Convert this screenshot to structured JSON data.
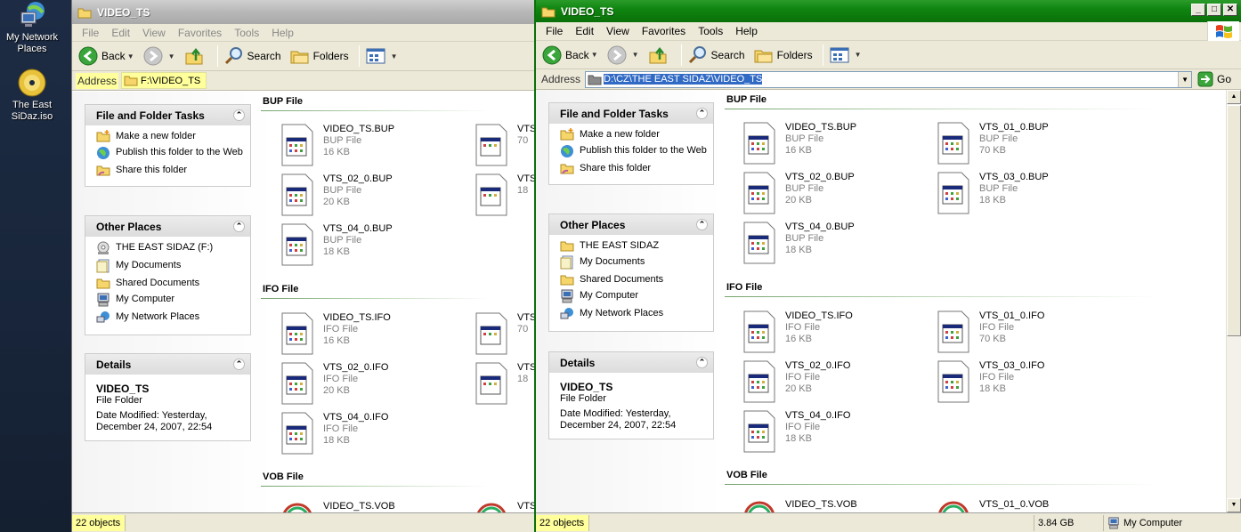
{
  "desktop": {
    "icons": [
      {
        "label": "My Network Places",
        "icon": "network-places-icon"
      },
      {
        "label": "The East SiDaz.iso",
        "icon": "cd-disc-icon"
      }
    ]
  },
  "menu": [
    "File",
    "Edit",
    "View",
    "Favorites",
    "Tools",
    "Help"
  ],
  "toolbar": {
    "back": "Back",
    "search": "Search",
    "folders": "Folders"
  },
  "colors": {
    "active_title": "#108510",
    "inactive_title": "#b7b7b7",
    "highlight": "#ffff9c",
    "selection": "#316ac5"
  },
  "left_window": {
    "title": "VIDEO_TS",
    "address_label": "Address",
    "address": "F:\\VIDEO_TS",
    "status": "22 objects",
    "other_places": [
      "THE EAST SIDAZ (F:)",
      "My Documents",
      "Shared Documents",
      "My Computer",
      "My Network Places"
    ]
  },
  "right_window": {
    "title": "VIDEO_TS",
    "address_label": "Address",
    "address": "D:\\CZ\\THE EAST SIDAZ\\VIDEO_TS",
    "go": "Go",
    "status": "22 objects",
    "status_size": "3.84 GB",
    "status_zone": "My Computer",
    "other_places": [
      "THE EAST SIDAZ",
      "My Documents",
      "Shared Documents",
      "My Computer",
      "My Network Places"
    ]
  },
  "tasks": {
    "title": "File and Folder Tasks",
    "items": [
      "Make a new folder",
      "Publish this folder to the Web",
      "Share this folder"
    ]
  },
  "other_places_title": "Other Places",
  "details": {
    "title": "Details",
    "name": "VIDEO_TS",
    "type": "File Folder",
    "modified": "Date Modified: Yesterday, December 24, 2007, 22:54"
  },
  "groups": [
    {
      "name": "BUP File",
      "files": [
        {
          "name": "VIDEO_TS.BUP",
          "type": "BUP File",
          "size": "16 KB"
        },
        {
          "name": "VTS_01_0.BUP",
          "type": "BUP File",
          "size": "70 KB"
        },
        {
          "name": "VTS_02_0.BUP",
          "type": "BUP File",
          "size": "20 KB"
        },
        {
          "name": "VTS_03_0.BUP",
          "type": "BUP File",
          "size": "18 KB"
        },
        {
          "name": "VTS_04_0.BUP",
          "type": "BUP File",
          "size": "18 KB"
        }
      ]
    },
    {
      "name": "IFO File",
      "files": [
        {
          "name": "VIDEO_TS.IFO",
          "type": "IFO File",
          "size": "16 KB"
        },
        {
          "name": "VTS_01_0.IFO",
          "type": "IFO File",
          "size": "70 KB"
        },
        {
          "name": "VTS_02_0.IFO",
          "type": "IFO File",
          "size": "20 KB"
        },
        {
          "name": "VTS_03_0.IFO",
          "type": "IFO File",
          "size": "18 KB"
        },
        {
          "name": "VTS_04_0.IFO",
          "type": "IFO File",
          "size": "18 KB"
        }
      ]
    },
    {
      "name": "VOB File",
      "files": [
        {
          "name": "VIDEO_TS.VOB",
          "type": "",
          "size": ""
        },
        {
          "name": "VTS_01_0.VOB",
          "type": "",
          "size": ""
        }
      ]
    }
  ],
  "left_truncated": {
    "bup": [
      {
        "name": "VTS",
        "size": "70"
      },
      {
        "name": "VTS",
        "size": "18"
      }
    ],
    "ifo": [
      {
        "name": "VTS",
        "size": "70"
      },
      {
        "name": "VTS",
        "size": "18"
      }
    ],
    "vob": [
      {
        "name": "VTS"
      }
    ]
  }
}
